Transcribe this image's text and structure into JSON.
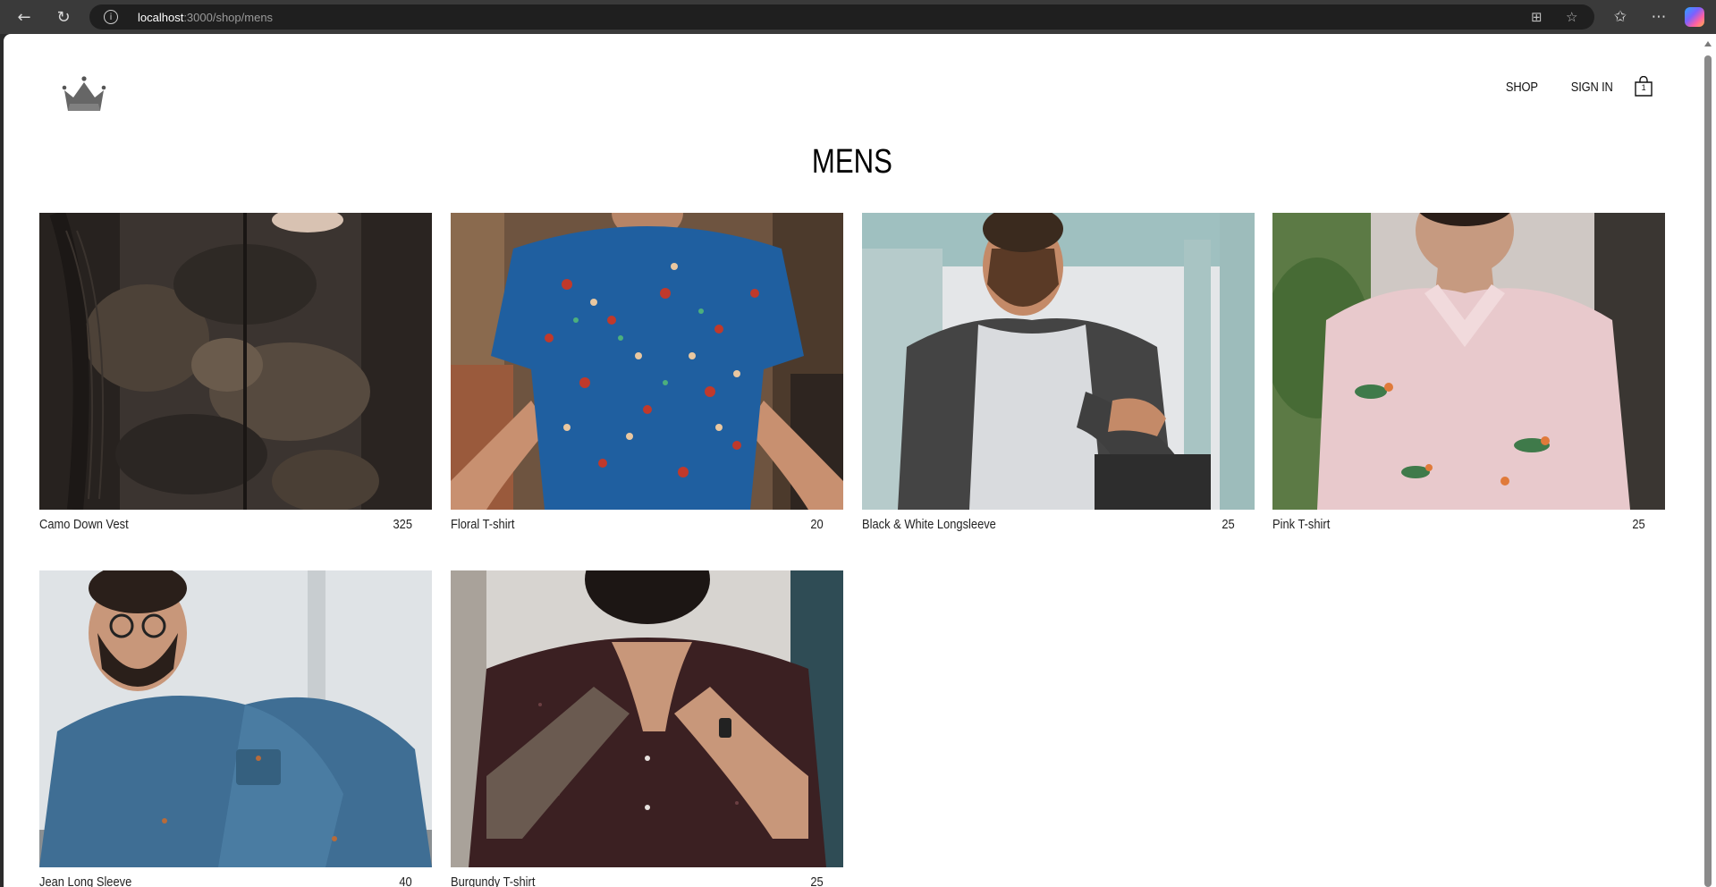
{
  "browser": {
    "url_host": "localhost",
    "url_path": ":3000/shop/mens",
    "back_icon": "arrow-left-icon",
    "reload_icon": "reload-icon"
  },
  "site": {
    "logo_icon": "crown-icon",
    "nav": {
      "shop_label": "SHOP",
      "signin_label": "SIGN IN",
      "cart_count": "1"
    },
    "page_title": "MENS"
  },
  "products": [
    {
      "name": "Camo Down Vest",
      "price": "325"
    },
    {
      "name": "Floral T-shirt",
      "price": "20"
    },
    {
      "name": "Black & White Longsleeve",
      "price": "25"
    },
    {
      "name": "Pink T-shirt",
      "price": "25"
    },
    {
      "name": "Jean Long Sleeve",
      "price": "40"
    },
    {
      "name": "Burgundy T-shirt",
      "price": "25"
    }
  ],
  "colors": {
    "page_background": "#ffffff",
    "text": "#111111",
    "browser_chrome": "#3a3a3a"
  }
}
